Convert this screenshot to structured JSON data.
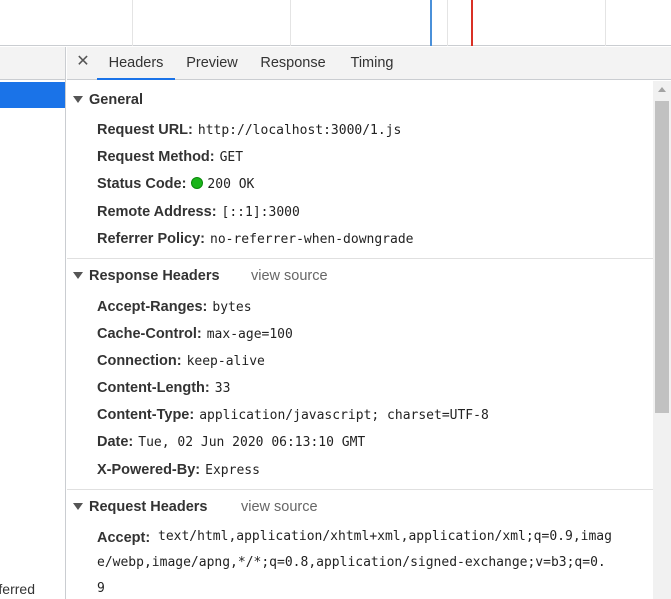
{
  "tabs": [
    {
      "label": "Headers",
      "active": true
    },
    {
      "label": "Preview",
      "active": false
    },
    {
      "label": "Response",
      "active": false
    },
    {
      "label": "Timing",
      "active": false
    }
  ],
  "close_icon": "close-icon",
  "left_list": {
    "bottom_text": "ferred"
  },
  "general": {
    "title": "General",
    "rows": [
      {
        "key": "Request URL:",
        "value": "http://localhost:3000/1.js"
      },
      {
        "key": "Request Method:",
        "value": "GET"
      },
      {
        "key": "Status Code:",
        "value": "200 OK"
      },
      {
        "key": "Remote Address:",
        "value": "[::1]:3000"
      },
      {
        "key": "Referrer Policy:",
        "value": "no-referrer-when-downgrade"
      }
    ]
  },
  "response_headers": {
    "title": "Response Headers",
    "view_source": "view source",
    "rows": [
      {
        "key": "Accept-Ranges:",
        "value": "bytes"
      },
      {
        "key": "Cache-Control:",
        "value": "max-age=100"
      },
      {
        "key": "Connection:",
        "value": "keep-alive"
      },
      {
        "key": "Content-Length:",
        "value": "33"
      },
      {
        "key": "Content-Type:",
        "value": "application/javascript; charset=UTF-8"
      },
      {
        "key": "Date:",
        "value": "Tue, 02 Jun 2020 06:13:10 GMT"
      },
      {
        "key": "X-Powered-By:",
        "value": "Express"
      }
    ]
  },
  "request_headers": {
    "title": "Request Headers",
    "view_source": "view source",
    "accept": {
      "key": "Accept:",
      "line1": "text/html,application/xhtml+xml,application/xml;q=0.9,imag",
      "line2": "e/webp,image/apng,*/*;q=0.8,application/signed-exchange;v=b3;q=0.",
      "line3": "9"
    }
  },
  "colors": {
    "accent": "#1a73e8",
    "status_ok": "#1bb51b",
    "timeline_blue": "#4a90d9",
    "timeline_red": "#d93025"
  }
}
